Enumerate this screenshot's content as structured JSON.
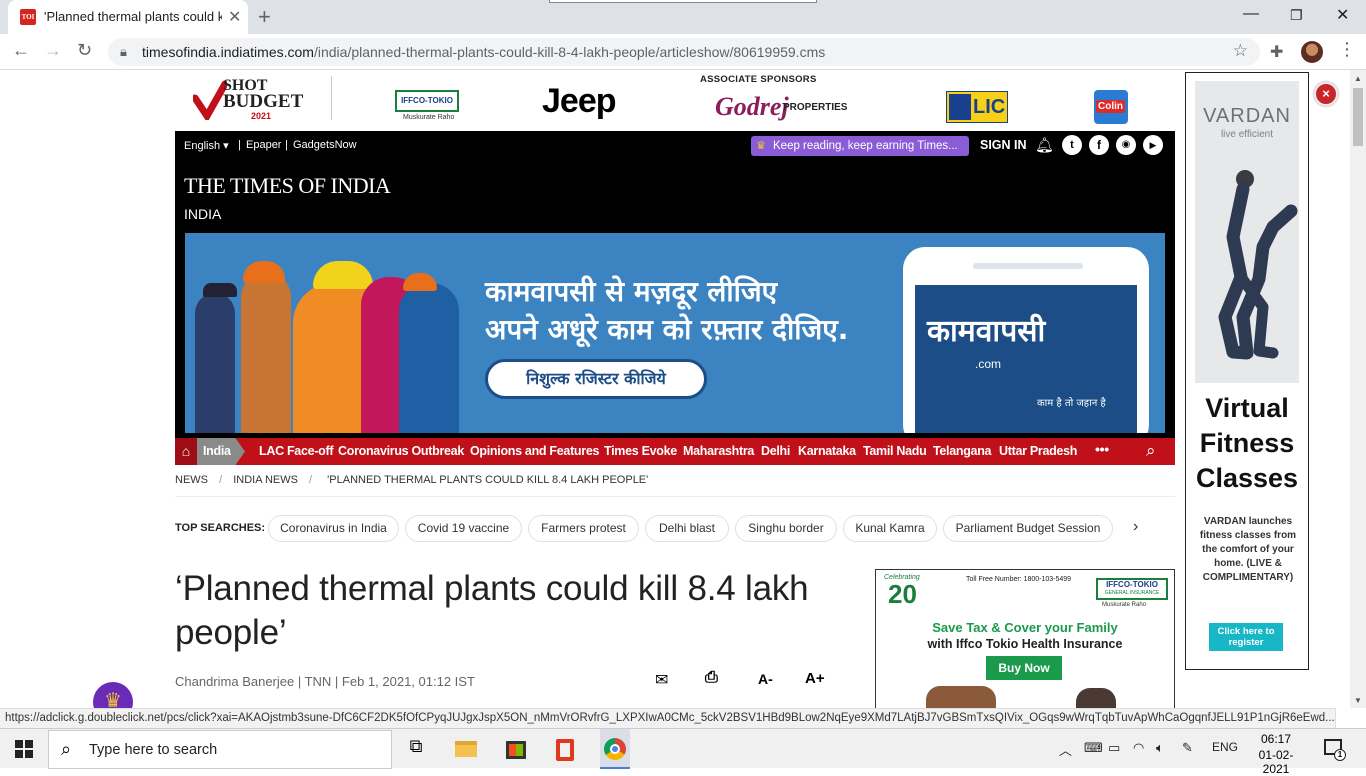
{
  "browser": {
    "tab_title": "'Planned thermal plants could kil",
    "favicon_text": "TOI",
    "url_host": "timesofindia.indiatimes.com",
    "url_path": "/india/planned-thermal-plants-could-kill-8-4-lakh-people/articleshow/80619959.cms"
  },
  "sponsors": {
    "logo1_line1": "SHOT",
    "logo1_line2": "BUDGET",
    "logo1_line3": "2021",
    "logo2": "IFFCO-TOKIO",
    "logo2_sub": "Muskurate Raho",
    "logo3": "Jeep",
    "associate_label": "ASSOCIATE SPONSORS",
    "logo4": "Godrej",
    "logo4_suffix": "PROPERTIES",
    "logo5": "LIC",
    "logo6": "Colin"
  },
  "topbar": {
    "language": "English",
    "epaper": "Epaper",
    "gadgets": "GadgetsNow",
    "promo": "Keep reading, keep earning Times...",
    "signin": "SIGN IN"
  },
  "masthead": {
    "title": "THE TIMES OF INDIA",
    "section": "INDIA"
  },
  "banner": {
    "line1": "कामवापसी से मज़दूर लीजिए",
    "line2": "अपने अधूरे काम को रफ़्तार दीजिए.",
    "cta": "निशुल्क रजिस्टर कीजिये",
    "brand": "कामवापसी",
    "brand_suffix": ".com",
    "tagline": "काम है तो जहान है"
  },
  "nav": {
    "items": [
      "India",
      "LAC Face-off",
      "Coronavirus Outbreak",
      "Opinions and Features",
      "Times Evoke",
      "Maharashtra",
      "Delhi",
      "Karnataka",
      "Tamil Nadu",
      "Telangana",
      "Uttar Pradesh"
    ],
    "more": "•••"
  },
  "breadcrumb": {
    "items": [
      "NEWS",
      "INDIA NEWS",
      "'PLANNED THERMAL PLANTS COULD KILL 8.4 LAKH PEOPLE'"
    ],
    "sep": "/"
  },
  "top_searches": {
    "label": "TOP SEARCHES:",
    "chips": [
      "Coronavirus in India",
      "Covid 19 vaccine",
      "Farmers protest",
      "Delhi blast",
      "Singhu border",
      "Kunal Kamra",
      "Parliament Budget Session"
    ]
  },
  "article": {
    "headline": "‘Planned thermal plants could kill 8.4 lakh people’",
    "byline": "Chandrima Banerjee | TNN | Feb 1, 2021, 01:12 IST",
    "font_down": "A-",
    "font_up": "A+"
  },
  "ad_right": {
    "years": "20",
    "celebrating": "Celebrating",
    "tollfree": "Toll Free Number: 1800-103-5499",
    "brand": "IFFCO-TOKIO",
    "brand_sub": "GENERAL INSURANCE",
    "brand_tag": "Muskurate Raho",
    "line1": "Save Tax & Cover your Family",
    "line2": "with Iffco Tokio Health Insurance",
    "cta": "Buy Now"
  },
  "ad_side": {
    "brand": "VARDAN",
    "brand_tag": "live efficient",
    "heading": "Virtual Fitness Classes",
    "body": "VARDAN launches fitness classes from the comfort of your home. (LIVE & COMPLIMENTARY)",
    "cta": "Click here to register"
  },
  "status_url": "https://adclick.g.doubleclick.net/pcs/click?xai=AKAOjstmb3sune-DfC6CF2DK5fOfCPyqJUJgxJspX5ON_nMmVrORvfrG_LXPXIwA0CMc_5ckV2BSV1HBd9BLow2NqEye9XMd7LAtjBJ7vGBSmTxsQIVix_OGqs9wWrqTqbTuvApWhCaOgqnfJELL91P1nGjR6eEwd...",
  "taskbar": {
    "search_placeholder": "Type here to search",
    "lang": "ENG",
    "time": "06:17",
    "date": "01-02-2021",
    "notif_count": "1"
  },
  "colors": {
    "toi_red": "#c0101a",
    "nav_dark": "#000000",
    "banner_blue": "#3c83c1",
    "promo_purple": "#8a5cd6"
  }
}
